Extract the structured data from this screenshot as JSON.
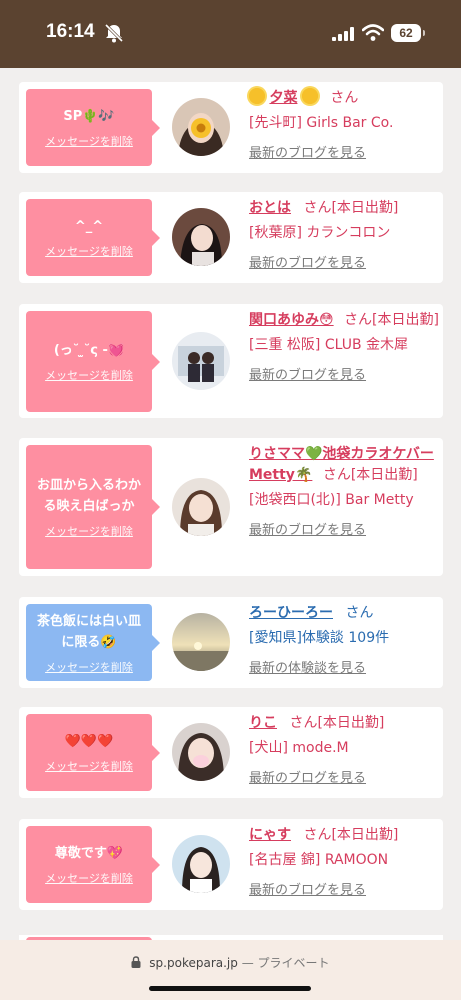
{
  "status_bar": {
    "time": "16:14",
    "battery": "62"
  },
  "messages": [
    {
      "bubble_text": "SP🌵🎶",
      "delete_label": "メッセージを削除",
      "name": "夕菜",
      "san": "さん",
      "shop": "[先斗町] Girls Bar Co.",
      "link": "最新のブログを見る"
    },
    {
      "bubble_text": "^_^",
      "delete_label": "メッセージを削除",
      "name": "おとは",
      "san": "さん[本日出勤]",
      "shop": "[秋葉原] カランコロン",
      "link": "最新のブログを見る"
    },
    {
      "bubble_text": "(っ˘ ̫˘ς -💓",
      "delete_label": "メッセージを削除",
      "name": "関口あゆみ😳",
      "san": "さん[本日出勤]",
      "shop": "[三重 松阪] CLUB 金木犀",
      "link": "最新のブログを見る"
    },
    {
      "bubble_text": "お皿から入るわかる映え白ばっか",
      "delete_label": "メッセージを削除",
      "name": "りさママ💚池袋カラオケバーMetty🌴",
      "san": "さん[本日出勤]",
      "shop": "[池袋西口(北)] Bar Metty",
      "link": "最新のブログを見る"
    },
    {
      "bubble_text": "茶色飯には白い皿に限る🤣",
      "delete_label": "メッセージを削除",
      "name": "ろーひーろー",
      "san": "さん",
      "shop": "[愛知県]体験談 109件",
      "link": "最新の体験談を見る"
    },
    {
      "bubble_text": "❤️❤️❤️",
      "delete_label": "メッセージを削除",
      "name": "りこ",
      "san": "さん[本日出勤]",
      "shop": "[犬山] mode.M",
      "link": "最新のブログを見る"
    },
    {
      "bubble_text": "尊敬です💖",
      "delete_label": "メッセージを削除",
      "name": "にゃす",
      "san": "さん[本日出勤]",
      "shop": "[名古屋 錦] RAMOON",
      "link": "最新のブログを見る"
    }
  ],
  "bottom_bar": {
    "url": "sp.pokepara.jp",
    "separator": " — ",
    "private": "プライベート"
  },
  "colors": {
    "status_bar_bg": "#5b4330",
    "pink_bubble": "#fe8fa1",
    "blue_bubble": "#8cb8f2",
    "name_pink": "#d63d5e",
    "name_blue": "#2b6cb0"
  }
}
